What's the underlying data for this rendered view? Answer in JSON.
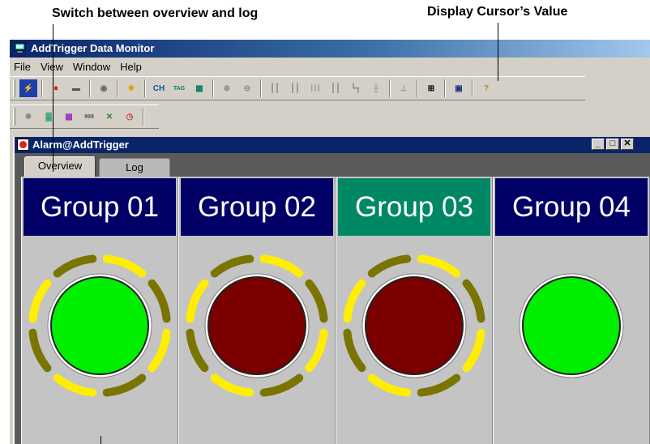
{
  "callouts": {
    "switch_tabs": "Switch between overview and log",
    "display_cursor": "Display Cursor’s Value"
  },
  "app": {
    "title": "AddTrigger Data Monitor",
    "menu": [
      "File",
      "View",
      "Window",
      "Help"
    ]
  },
  "toolbar1": [
    {
      "name": "connect-icon",
      "label": "⚡",
      "bg": "#1f3fa8",
      "fg": "#ffd400"
    },
    {
      "name": "stop-icon",
      "label": "⏸",
      "bg": "#d4d0c8",
      "fg": "#e00000"
    },
    {
      "name": "record-icon",
      "label": "▬",
      "bg": "#d4d0c8",
      "fg": "#555555"
    },
    {
      "name": "target-icon",
      "label": "◉",
      "bg": "#d4d0c8",
      "fg": "#666666"
    },
    {
      "name": "trigger-icon",
      "label": "✸",
      "bg": "#d4d0c8",
      "fg": "#e0a000"
    },
    {
      "name": "channel-icon",
      "label": "CH",
      "bg": "#d4d0c8",
      "fg": "#0060a0"
    },
    {
      "name": "tag-icon",
      "label": "TAG",
      "bg": "#d4d0c8",
      "fg": "#008060"
    },
    {
      "name": "grid-icon",
      "label": "▦",
      "bg": "#d4d0c8",
      "fg": "#008060"
    },
    {
      "name": "zoom-in-icon",
      "label": "⊕",
      "bg": "#d4d0c8",
      "fg": "#888888"
    },
    {
      "name": "zoom-out-icon",
      "label": "⊖",
      "bg": "#d4d0c8",
      "fg": "#888888"
    },
    {
      "name": "bars-icon",
      "label": "┃┃",
      "bg": "#d4d0c8",
      "fg": "#999999"
    },
    {
      "name": "bars2-icon",
      "label": "┃┃",
      "bg": "#d4d0c8",
      "fg": "#999999"
    },
    {
      "name": "bars3-icon",
      "label": "┃┃┃",
      "bg": "#d4d0c8",
      "fg": "#999999"
    },
    {
      "name": "bars4-icon",
      "label": "┃┃",
      "bg": "#d4d0c8",
      "fg": "#999999"
    },
    {
      "name": "step-icon",
      "label": "┗┓",
      "bg": "#d4d0c8",
      "fg": "#999999"
    },
    {
      "name": "split-icon",
      "label": "╫",
      "bg": "#d4d0c8",
      "fg": "#999999"
    },
    {
      "name": "fit-icon",
      "label": "⊥",
      "bg": "#d4d0c8",
      "fg": "#999999"
    },
    {
      "name": "cursor-value-icon",
      "label": "⊞",
      "bg": "#d4d0c8",
      "fg": "#000000"
    },
    {
      "name": "print-icon",
      "label": "▣",
      "bg": "#d4d0c8",
      "fg": "#203080"
    },
    {
      "name": "help-icon",
      "label": "?",
      "bg": "#d4d0c8",
      "fg": "#c08000"
    }
  ],
  "toolbar1_separators_after": [
    0,
    2,
    3,
    4,
    7,
    9,
    15,
    16,
    17,
    18
  ],
  "toolbar2": [
    {
      "name": "settings-icon",
      "label": "✹",
      "bg": "#d4d0c8",
      "fg": "#888888"
    },
    {
      "name": "color-icon",
      "label": "▓",
      "bg": "#d4d0c8",
      "fg": "#20a060"
    },
    {
      "name": "palette-icon",
      "label": "▩",
      "bg": "#d4d0c8",
      "fg": "#a030c0"
    },
    {
      "name": "counter-icon",
      "label": "999",
      "bg": "#d4d0c8",
      "fg": "#505050"
    },
    {
      "name": "mark-icon",
      "label": "✕",
      "bg": "#d4d0c8",
      "fg": "#308030"
    },
    {
      "name": "timer-icon",
      "label": "◷",
      "bg": "#d4d0c8",
      "fg": "#d03030"
    }
  ],
  "child": {
    "title": "Alarm@AddTrigger",
    "controls": [
      "_",
      "□",
      "✕"
    ]
  },
  "tabs": {
    "overview": "Overview",
    "log": "Log"
  },
  "groups": [
    {
      "label": "Group 01",
      "header_color": "#000066",
      "lamp": "#00ee00",
      "lamp_dark": "#009000",
      "ring": true
    },
    {
      "label": "Group 02",
      "header_color": "#000066",
      "lamp": "#7a0000",
      "lamp_dark": "#400000",
      "ring": true
    },
    {
      "label": "Group 03",
      "header_color": "#008866",
      "lamp": "#7a0000",
      "lamp_dark": "#400000",
      "ring": true
    },
    {
      "label": "Group 04",
      "header_color": "#000066",
      "lamp": "#00ee00",
      "lamp_dark": "#009000",
      "ring": false
    }
  ]
}
